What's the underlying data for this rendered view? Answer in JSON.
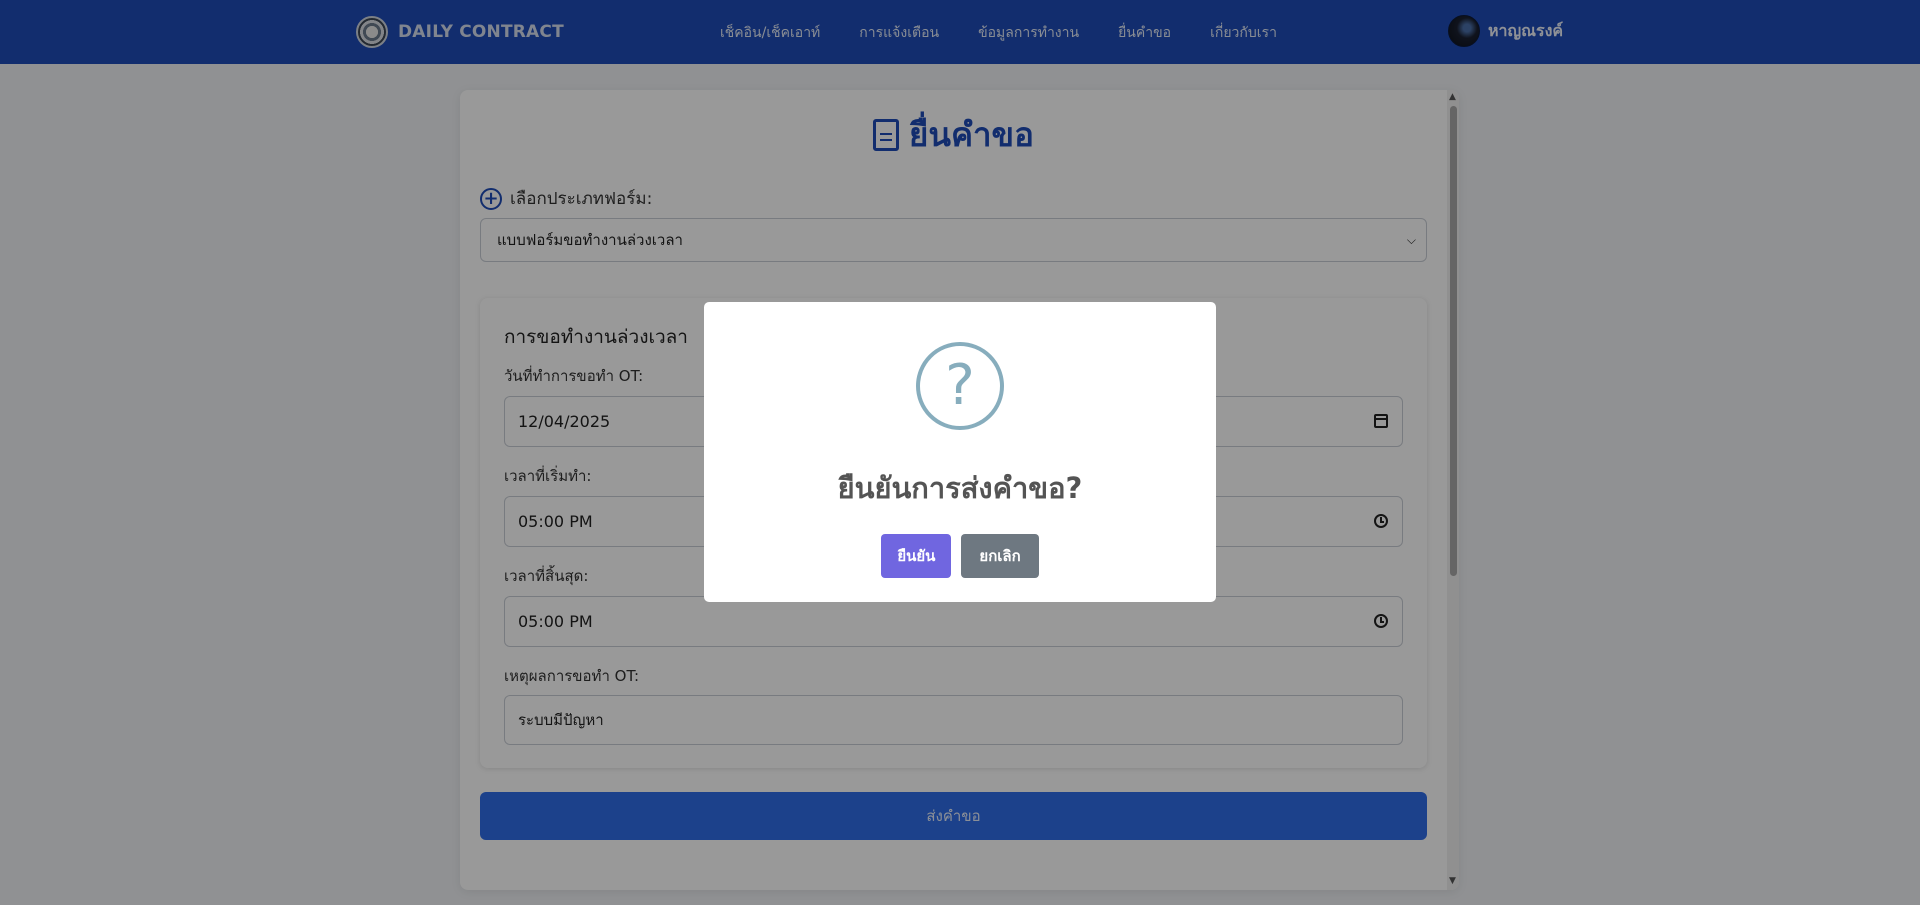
{
  "navbar": {
    "brand": "DAILY CONTRACT",
    "links": [
      "เช็คอิน/เช็คเอาท์",
      "การแจ้งเตือน",
      "ข้อมูลการทำงาน",
      "ยื่นคำขอ",
      "เกี่ยวกับเรา"
    ],
    "username": "หาญณรงค์",
    "color": "#1e4cb8"
  },
  "page": {
    "title": "ยื่นคำขอ",
    "form_type_label": "เลือกประเภทฟอร์ม:",
    "form_type_value": "แบบฟอร์มขอทำงานล่วงเวลา"
  },
  "form": {
    "title": "การขอทำงานล่วงเวลา",
    "fields": [
      {
        "label": "วันที่ทำการขอทำ OT:",
        "value": "12/04/2025",
        "icon": "calendar-icon"
      },
      {
        "label": "เวลาที่เริ่มทำ:",
        "value": "05:00 PM",
        "icon": "clock-icon"
      },
      {
        "label": "เวลาที่สิ้นสุด:",
        "value": "05:00 PM",
        "icon": "clock-icon"
      },
      {
        "label": "เหตุผลการขอทำ OT:",
        "value": "ระบบมีปัญหา"
      }
    ],
    "submit_label": "ส่งคำขอ"
  },
  "modal": {
    "icon": "question-icon",
    "icon_glyph": "?",
    "title": "ยืนยันการส่งคำขอ?",
    "confirm_label": "ยืนยัน",
    "cancel_label": "ยกเลิก",
    "confirm_color": "#7066e0",
    "cancel_color": "#6e7881"
  }
}
